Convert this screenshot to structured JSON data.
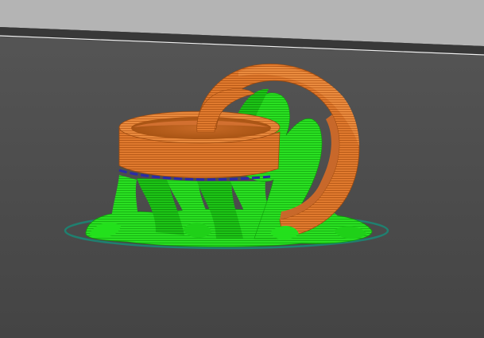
{
  "viewport": {},
  "colors": {
    "background_far": "#b4b4b4",
    "build_plate": "#4a4a4a",
    "plate_edge": "#f2f2f2",
    "model_orange": "#e07a2e",
    "model_orange_dark": "#b85a18",
    "support_green": "#23e01c",
    "support_green_dark": "#13a80f",
    "skirt_teal": "#1f8070",
    "first_layer_blue": "#2a2aa8"
  },
  "scene_objects": [
    "build-plate",
    "skirt-outline",
    "tree-support-structure",
    "ring-model",
    "arch-loop-model"
  ]
}
